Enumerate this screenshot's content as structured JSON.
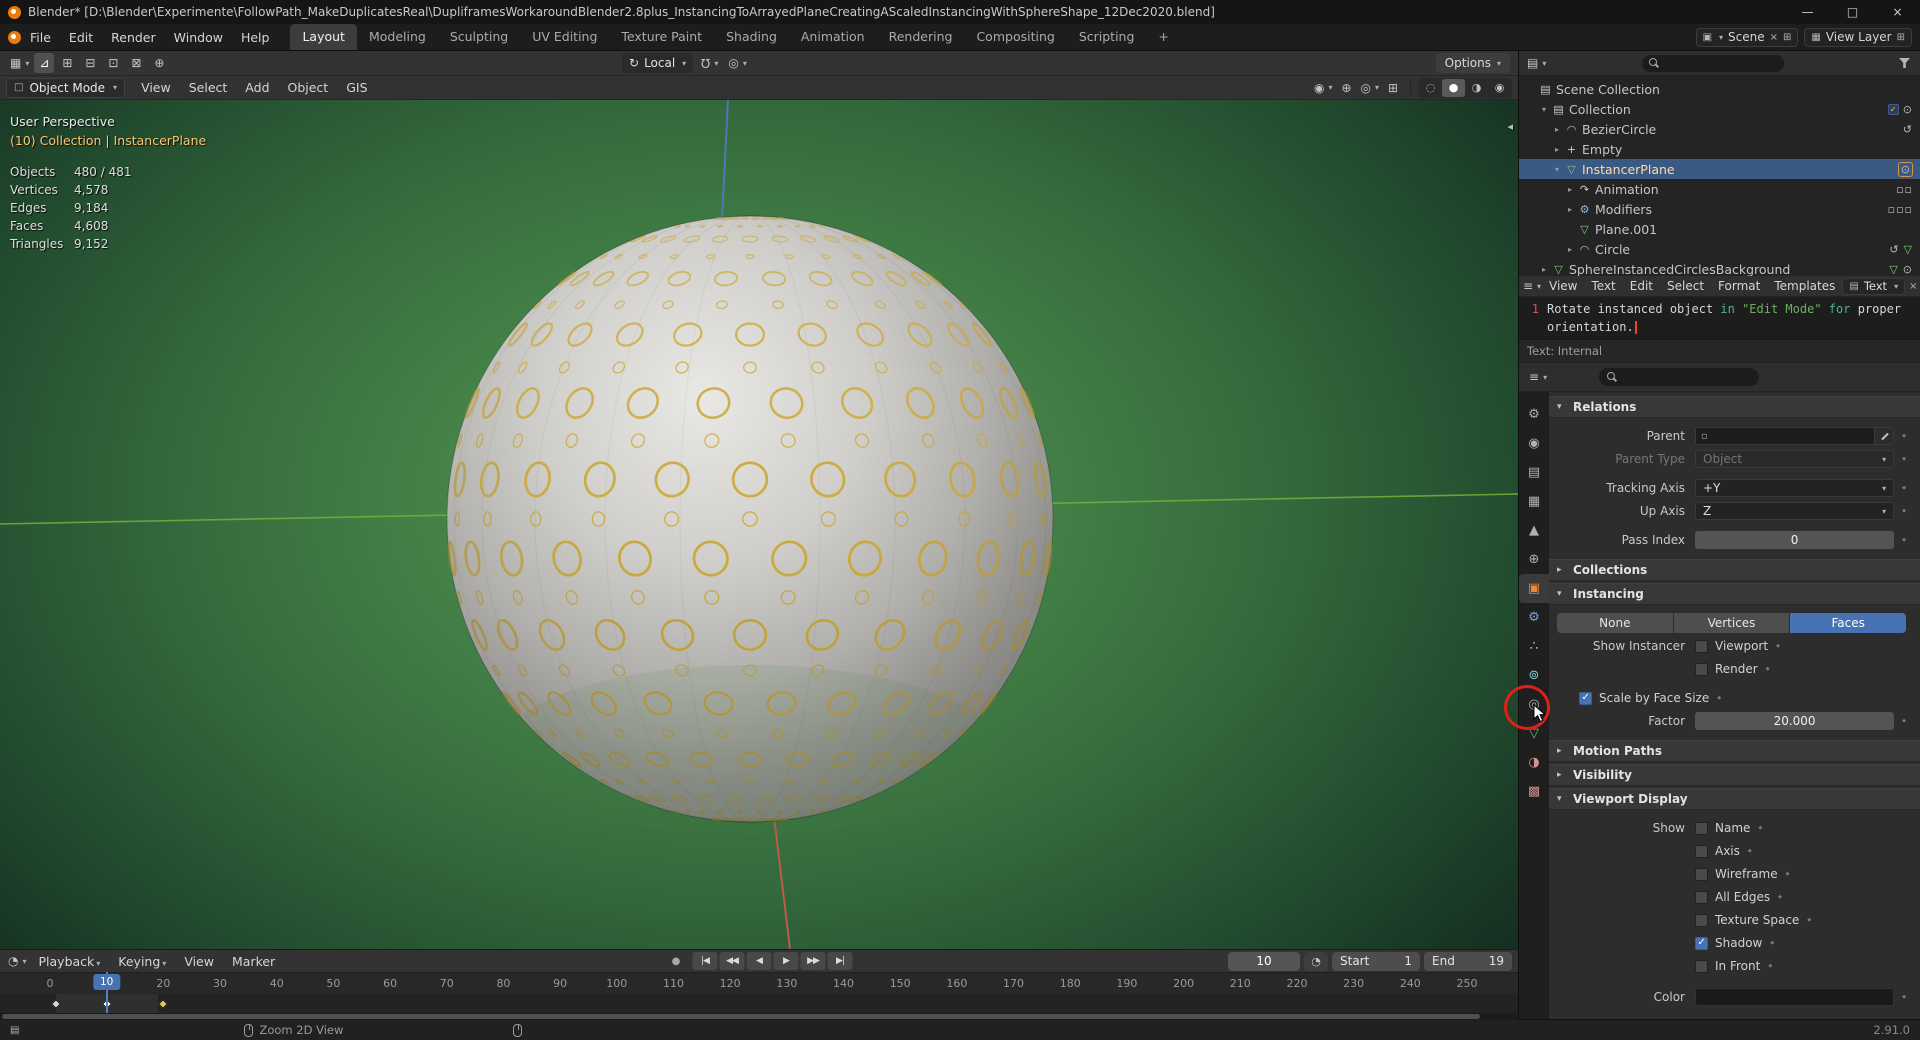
{
  "titlebar": {
    "title": "Blender* [D:\\Blender\\Experimente\\FollowPath_MakeDuplicatesReal\\DupliframesWorkaroundBlender2.8plus_InstancingToArrayedPlaneCreatingAScaledInstancingWithSphereShape_12Dec2020.blend]"
  },
  "icons": {
    "caret-down": "▾",
    "expand-right": "▸",
    "window-minimize": "—",
    "window-maximize": "□",
    "window-close": "×",
    "editor-3d-viewport": "▦",
    "editor-outliner": "▤",
    "editor-text": "≡",
    "editor-properties": "≡",
    "editor-timeline": "◔",
    "tool-cursor": "⊿",
    "select-1": "⊞",
    "select-2": "⊟",
    "select-3": "⊡",
    "select-4": "⊠",
    "transform-orientation": "↻",
    "snap-magnet": "Ω",
    "proportional": "◎",
    "visibility": "◉",
    "gizmo": "⊕",
    "overlays": "◎",
    "xray": "⊞",
    "shade-wireframe": "◌",
    "shade-solid": "●",
    "shade-material": "◑",
    "shade-rendered": "◉",
    "mode-object": "□",
    "scene": "▣",
    "view-layer": "▦",
    "duplicate": "⊞",
    "close-x": "×",
    "datablock": "▤",
    "clock": "◔",
    "record": "●",
    "collapse-left": "◂",
    "status-file": "▤",
    "eye": "⊙",
    "parent-object": "▫"
  },
  "topbar": {
    "menus": [
      "File",
      "Edit",
      "Render",
      "Window",
      "Help"
    ],
    "workspaces": [
      "Layout",
      "Modeling",
      "Sculpting",
      "UV Editing",
      "Texture Paint",
      "Shading",
      "Animation",
      "Rendering",
      "Compositing",
      "Scripting"
    ],
    "active_workspace": "Layout",
    "add_workspace": "+",
    "scene_label": "Scene",
    "view_layer_label": "View Layer"
  },
  "tool_header": {
    "transform_orientation": "Local",
    "options": "Options"
  },
  "viewport_header": {
    "mode": "Object Mode",
    "menus": [
      "View",
      "Select",
      "Add",
      "Object",
      "GIS"
    ]
  },
  "viewport": {
    "view_label": "User Perspective",
    "context_label": "(10) Collection | InstancerPlane",
    "stats": [
      {
        "label": "Objects",
        "value": "480 / 481"
      },
      {
        "label": "Vertices",
        "value": "4,578"
      },
      {
        "label": "Edges",
        "value": "9,184"
      },
      {
        "label": "Faces",
        "value": "4,608"
      },
      {
        "label": "Triangles",
        "value": "9,152"
      }
    ]
  },
  "outliner": {
    "icon_glyphs": {
      "collection": "▤",
      "curve": "◠",
      "empty": "+",
      "mesh": "▽",
      "mesh-data": "▽",
      "animation": "↷",
      "modifier": "⚙"
    },
    "icon_colors": {
      "collection": "#c9c9c9",
      "curve": "#a8c79e",
      "empty": "#cccccc",
      "mesh": "#7ecb7e",
      "mesh-data": "#7ecb7e",
      "animation": "#cccccc",
      "modifier": "#8fb5e0"
    },
    "right_glyphs": {
      "eye": "⊙",
      "curve-data": "↺",
      "strips": "▫▫",
      "toggles": "▫▫▫",
      "mesh-data": "▽"
    },
    "right_colors": {
      "mesh-data": "#7ecb7e"
    },
    "rows": [
      {
        "label": "Scene Collection",
        "indent": 0,
        "icon": "collection",
        "expanded": null,
        "selected": false,
        "right": []
      },
      {
        "label": "Collection",
        "indent": 1,
        "icon": "collection",
        "expanded": true,
        "selected": false,
        "right": [
          "checkbox",
          "eye"
        ]
      },
      {
        "label": "BezierCircle",
        "indent": 2,
        "icon": "curve",
        "expanded": false,
        "selected": false,
        "right": [
          "curve-data"
        ]
      },
      {
        "label": "Empty",
        "indent": 2,
        "icon": "empty",
        "expanded": false,
        "selected": false,
        "right": []
      },
      {
        "label": "InstancerPlane",
        "indent": 2,
        "icon": "mesh",
        "expanded": true,
        "selected": true,
        "active": true,
        "right": [
          "eye-boxed"
        ]
      },
      {
        "label": "Animation",
        "indent": 3,
        "icon": "animation",
        "expanded": false,
        "selected": false,
        "right": [
          "strips"
        ]
      },
      {
        "label": "Modifiers",
        "indent": 3,
        "icon": "modifier",
        "expanded": false,
        "selected": false,
        "right": [
          "toggles"
        ]
      },
      {
        "label": "Plane.001",
        "indent": 3,
        "icon": "mesh-data",
        "expanded": null,
        "selected": false,
        "right": []
      },
      {
        "label": "Circle",
        "indent": 3,
        "icon": "curve",
        "expanded": false,
        "selected": false,
        "right": [
          "curve-data",
          "mesh-data"
        ]
      },
      {
        "label": "SphereInstancedCirclesBackground",
        "indent": 1,
        "icon": "mesh",
        "expanded": false,
        "selected": false,
        "right": [
          "mesh-data",
          "eye"
        ]
      }
    ]
  },
  "text_editor": {
    "menus": [
      "View",
      "Text",
      "Edit",
      "Select",
      "Format",
      "Templates"
    ],
    "datablock": "Text",
    "lines": [
      {
        "no": "1",
        "cursor": false,
        "segments": [
          {
            "t": "Rotate instanced object ",
            "c": "plain"
          },
          {
            "t": "in",
            "c": "keyword"
          },
          {
            "t": " ",
            "c": "plain"
          },
          {
            "t": "\"Edit Mode\"",
            "c": "string"
          },
          {
            "t": " ",
            "c": "plain"
          },
          {
            "t": "for",
            "c": "keyword"
          },
          {
            "t": " proper",
            "c": "plain"
          }
        ]
      },
      {
        "no": "",
        "cursor": true,
        "segments": [
          {
            "t": "orientation.",
            "c": "plain"
          }
        ]
      }
    ],
    "footer": "Text: Internal"
  },
  "properties": {
    "tabs": [
      {
        "name": "tool",
        "glyph": "⚙",
        "color": "#b0b0b0"
      },
      {
        "name": "render",
        "glyph": "◉",
        "color": "#b0b0b0"
      },
      {
        "name": "output",
        "glyph": "▤",
        "color": "#b0b0b0"
      },
      {
        "name": "view-layer",
        "glyph": "▦",
        "color": "#b0b0b0"
      },
      {
        "name": "scene",
        "glyph": "▲",
        "color": "#b0b0b0"
      },
      {
        "name": "world",
        "glyph": "⊕",
        "color": "#b0b0b0"
      },
      {
        "name": "object",
        "glyph": "▣",
        "color": "#e8883a",
        "active": true
      },
      {
        "name": "modifiers",
        "glyph": "⚙",
        "color": "#7aa2d8"
      },
      {
        "name": "particles",
        "glyph": "∴",
        "color": "#9fd8e8"
      },
      {
        "name": "physics",
        "glyph": "⊚",
        "color": "#7ad0e0"
      },
      {
        "name": "constraints",
        "glyph": "◎",
        "color": "#b0b0b0"
      },
      {
        "name": "object-data",
        "glyph": "▽",
        "color": "#63c763"
      },
      {
        "name": "material",
        "glyph": "◑",
        "color": "#d88f8f"
      },
      {
        "name": "texture",
        "glyph": "▩",
        "color": "#cb8b8b"
      }
    ],
    "relations": {
      "title": "Relations",
      "parent_label": "Parent",
      "parent_type_label": "Parent Type",
      "parent_type_value": "Object",
      "tracking_axis_label": "Tracking Axis",
      "tracking_axis_value": "+Y",
      "up_axis_label": "Up Axis",
      "up_axis_value": "Z",
      "pass_index_label": "Pass Index",
      "pass_index_value": "0"
    },
    "collections_title": "Collections",
    "instancing": {
      "title": "Instancing",
      "modes": [
        "None",
        "Vertices",
        "Faces"
      ],
      "active_mode": "Faces",
      "show_instancer_label": "Show Instancer",
      "viewport_label": "Viewport",
      "render_label": "Render",
      "scale_by_face_label": "Scale by Face Size",
      "factor_label": "Factor",
      "factor_value": "20.000"
    },
    "motion_paths_title": "Motion Paths",
    "visibility_title": "Visibility",
    "viewport_display": {
      "title": "Viewport Display",
      "show_label": "Show",
      "checkboxes": [
        {
          "label": "Name",
          "checked": false
        },
        {
          "label": "Axis",
          "checked": false
        },
        {
          "label": "Wireframe",
          "checked": false
        },
        {
          "label": "All Edges",
          "checked": false
        },
        {
          "label": "Texture Space",
          "checked": false
        },
        {
          "label": "Shadow",
          "checked": true
        },
        {
          "label": "In Front",
          "checked": false
        }
      ],
      "color_label": "Color"
    }
  },
  "timeline": {
    "menus": [
      {
        "label": "Playback",
        "caret": true
      },
      {
        "label": "Keying",
        "caret": true
      },
      {
        "label": "View"
      },
      {
        "label": "Marker"
      }
    ],
    "transport": [
      {
        "name": "jump-to-start",
        "label": "|◀"
      },
      {
        "name": "previous-keyframe",
        "label": "◀◀"
      },
      {
        "name": "play-reverse",
        "label": "◀"
      },
      {
        "name": "play",
        "label": "▶"
      },
      {
        "name": "next-keyframe",
        "label": "▶▶"
      },
      {
        "name": "jump-to-end",
        "label": "▶|"
      }
    ],
    "current_frame": "10",
    "start_label": "Start",
    "start_value": "1",
    "end_label": "End",
    "end_value": "19",
    "ruler_frames": [
      0,
      10,
      20,
      30,
      40,
      50,
      60,
      70,
      80,
      90,
      100,
      110,
      120,
      130,
      140,
      150,
      160,
      170,
      180,
      190,
      200,
      210,
      220,
      230,
      240,
      250
    ],
    "range_start": 1,
    "range_end": 19,
    "playhead_frame": 10,
    "keyframes": [
      {
        "frame": 1,
        "color": "#d8d8d8"
      },
      {
        "frame": 10,
        "color": "#ffffff"
      },
      {
        "frame": 20,
        "color": "#e3c84b"
      }
    ]
  },
  "statusbar": {
    "hint": "Zoom 2D View",
    "version": "2.91.0"
  }
}
